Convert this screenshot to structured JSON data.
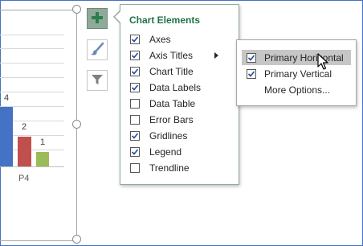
{
  "chart": {
    "data_labels": [
      "4",
      "2",
      "1"
    ],
    "category": "P4",
    "series_colors": [
      "#4472c4",
      "#c0504d",
      "#9bbb59"
    ]
  },
  "side_buttons": [
    {
      "name": "chart-elements-button",
      "icon": "plus-icon",
      "active": true
    },
    {
      "name": "chart-styles-button",
      "icon": "paintbrush-icon",
      "active": false
    },
    {
      "name": "chart-filters-button",
      "icon": "filter-icon",
      "active": false
    }
  ],
  "panel": {
    "title": "Chart Elements",
    "items": [
      {
        "label": "Axes",
        "checked": true
      },
      {
        "label": "Axis Titles",
        "checked": true,
        "submenu": true
      },
      {
        "label": "Chart Title",
        "checked": true
      },
      {
        "label": "Data Labels",
        "checked": true
      },
      {
        "label": "Data Table",
        "checked": false
      },
      {
        "label": "Error Bars",
        "checked": false
      },
      {
        "label": "Gridlines",
        "checked": true
      },
      {
        "label": "Legend",
        "checked": true
      },
      {
        "label": "Trendline",
        "checked": false
      }
    ]
  },
  "submenu": {
    "items": [
      {
        "label": "Primary Horizontal",
        "checked": true,
        "hover": true
      },
      {
        "label": "Primary Vertical",
        "checked": true,
        "hover": false
      },
      {
        "label": "More Options...",
        "checked": null,
        "hover": false
      }
    ]
  },
  "colors": {
    "accent": "#217346",
    "selection": "#4472c4"
  }
}
